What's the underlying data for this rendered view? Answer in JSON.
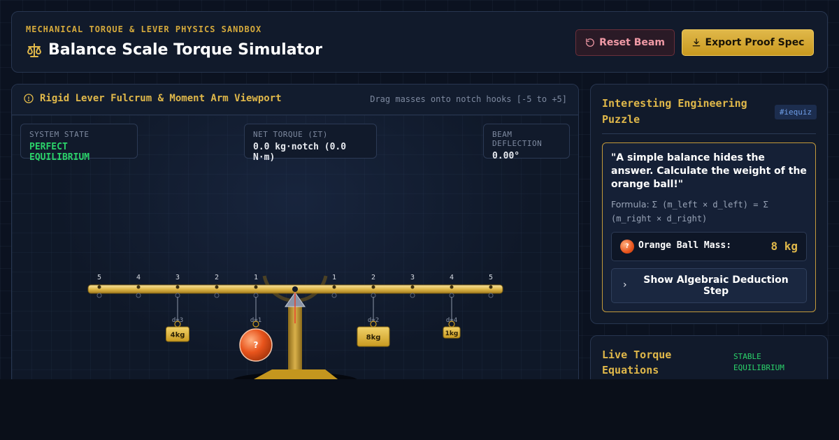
{
  "header": {
    "eyebrow": "MECHANICAL TORQUE & LEVER PHYSICS SANDBOX",
    "title": "Balance Scale Torque Simulator",
    "reset_label": "Reset Beam",
    "export_label": "Export Proof Spec"
  },
  "viewport": {
    "title": "Rigid Lever Fulcrum & Moment Arm Viewport",
    "hint": "Drag masses onto notch hooks [-5 to +5]",
    "stats": {
      "system_state_label": "SYSTEM STATE",
      "system_state_value": "PERFECT EQUILIBRIUM",
      "net_torque_label": "NET TORQUE (ΣT)",
      "net_torque_value": "0.0 kg·notch (0.0 N·m)",
      "deflection_label": "BEAM DEFLECTION",
      "deflection_value": "0.00°"
    },
    "notch_labels": [
      "5",
      "4",
      "3",
      "2",
      "1",
      "1",
      "2",
      "3",
      "4",
      "5"
    ],
    "masses": [
      {
        "side": "left",
        "notch": 3,
        "distance_label": "d=3",
        "label": "4kg",
        "kind": "block"
      },
      {
        "side": "left",
        "notch": 1,
        "distance_label": "d=1",
        "label": "?",
        "kind": "ball"
      },
      {
        "side": "right",
        "notch": 2,
        "distance_label": "d=2",
        "label": "8kg",
        "kind": "block"
      },
      {
        "side": "right",
        "notch": 4,
        "distance_label": "d=4",
        "label": "1kg",
        "kind": "block"
      }
    ]
  },
  "puzzle": {
    "title": "Interesting Engineering Puzzle",
    "tag": "#iequiz",
    "question": "\"A simple balance hides the answer. Calculate the weight of the orange ball!\"",
    "formula_prefix": "Formula: ",
    "formula": "Σ (m_left × d_left) = Σ (m_right × d_right)",
    "mass_icon": "?",
    "mass_label": "Orange Ball Mass:",
    "mass_value": "8 kg",
    "deduce_label": "Show Algebraic Deduction Step"
  },
  "live": {
    "title": "Live Torque Equations",
    "status": "STABLE EQUILIBRIUM"
  },
  "colors": {
    "accent_gold": "#e0b84a",
    "success_green": "#2bd36a",
    "danger_pink": "#f19aa6",
    "ball_orange": "#e8541c"
  }
}
